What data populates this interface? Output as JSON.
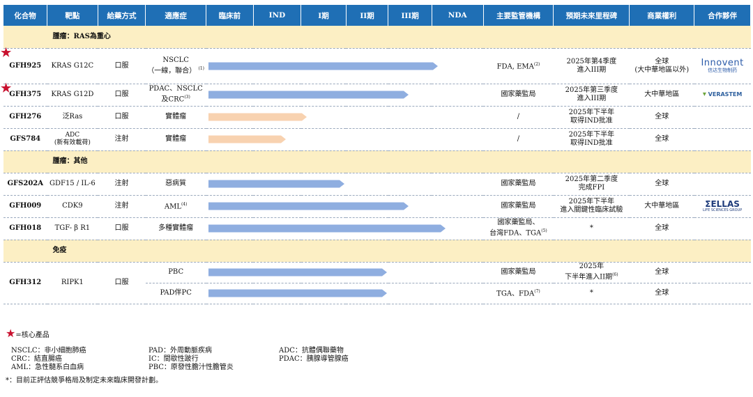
{
  "header": {
    "compound": "化合物",
    "target": "靶點",
    "route": "給藥方式",
    "indication": "適應症",
    "preclinical": "臨床前",
    "ind": "IND",
    "phase1": "I期",
    "phase2": "II期",
    "phase3": "III期",
    "nda": "NDA",
    "regulator": "主要監管機構",
    "milestone": "預期未來里程碑",
    "rights": "商業權利",
    "partner": "合作夥伴"
  },
  "sections": {
    "ras": "腫瘤：RAS為重心",
    "other": "腫瘤：其他",
    "immune": "免疫"
  },
  "rows": {
    "gfh925": {
      "compound": "GFH925",
      "target": "KRAS G12C",
      "route": "口服",
      "ind1": "NSCLC",
      "ind2": "（一線，聯合）",
      "ind_sup": "(1)",
      "regulator": "FDA, EMA",
      "reg_sup": "(2)",
      "ms1": "2025年第4季度",
      "ms2": "進入III期",
      "rights1": "全球",
      "rights2": "(大中華地區以外)",
      "partner_a": "Innovent",
      "partner_b": "信达生物制药",
      "progress": "Phase II"
    },
    "gfh375": {
      "compound": "GFH375",
      "target": "KRAS G12D",
      "route": "口服",
      "ind1": "PDAC、NSCLC",
      "ind2": "及CRC",
      "ind_sup": "(3)",
      "regulator": "國家藥監局",
      "ms1": "2025年第三季度",
      "ms2": "進入III期",
      "rights1": "大中華地區",
      "partner_a": "VERASTEM",
      "progress": "Phase II"
    },
    "gfh276": {
      "compound": "GFH276",
      "target": "泛Ras",
      "route": "口服",
      "ind1": "實體瘤",
      "regulator": "/",
      "ms1": "2025年下半年",
      "ms2": "取得IND批准",
      "rights1": "全球",
      "progress": "Preclinical"
    },
    "gfs784": {
      "compound": "GFS784",
      "target1": "ADC",
      "target2": "(新有效載荷)",
      "route": "注射",
      "ind1": "實體瘤",
      "regulator": "/",
      "ms1": "2025年下半年",
      "ms2": "取得IND批准",
      "rights1": "全球",
      "progress": "Preclinical"
    },
    "gfs202a": {
      "compound": "GFS202A",
      "target": "GDF15 / IL-6",
      "route": "注射",
      "ind1": "惡病質",
      "regulator": "國家藥監局",
      "ms1": "2025年第二季度",
      "ms2": "完成FPI",
      "rights1": "全球",
      "progress": "Phase I"
    },
    "gfh009": {
      "compound": "GFH009",
      "target": "CDK9",
      "route": "注射",
      "ind1": "AML",
      "ind_sup": "(4)",
      "regulator": "國家藥監局",
      "ms1": "2025年下半年",
      "ms2": "進入關鍵性臨床試驗",
      "rights1": "大中華地區",
      "partner_a": "ΣELLAS",
      "partner_b": "LIFE SCIENCES GROUP",
      "progress": "Phase II"
    },
    "gfh018": {
      "compound": "GFH018",
      "target": "TGF- β R1",
      "route": "口服",
      "ind1": "多種實體瘤",
      "regulator": "國家藥監局、",
      "regulator2": "台灣FDA、TGA",
      "reg_sup": "(5)",
      "ms1": "*",
      "rights1": "全球",
      "progress": "Phase II"
    },
    "gfh312": {
      "compound": "GFH312",
      "target": "RIPK1",
      "route": "口服",
      "sub1": {
        "ind1": "PBC",
        "regulator": "國家藥監局",
        "ms1": "2025年",
        "ms2": "下半年進入II期",
        "ms_sup": "(6)",
        "rights1": "全球",
        "progress": "Phase II"
      },
      "sub2": {
        "ind1": "PAD伴PC",
        "regulator": "TGA、FDA",
        "reg_sup": "(7)",
        "ms1": "*",
        "rights1": "全球",
        "progress": "Phase II"
      }
    }
  },
  "bar_fill": {
    "gfh925": 0.86,
    "gfh375": 0.75,
    "gfh276": 0.37,
    "gfs784": 0.29,
    "gfs202a": 0.51,
    "gfh009": 0.75,
    "gfh018": 0.89,
    "gfh312a": 0.67,
    "gfh312b": 0.67
  },
  "colors": {
    "header_bg": "#1f6fb5",
    "section_bg": "#fcefc4",
    "bar_blue": "#8faee0",
    "bar_peach": "#f8d2b0",
    "star": "#c8102e"
  },
  "legend": {
    "core": "=核心產品",
    "nsclc": "NSCLC：非小細胞肺癌",
    "crc": "CRC：結直腸癌",
    "aml": "AML：急性髓系白血病",
    "pad": "PAD：外周動脈疾病",
    "ic": "IC：間歇性跛行",
    "pbc": "PBC：原發性膽汁性膽管炎",
    "adc": "ADC：抗體偶聯藥物",
    "pdac": "PDAC：胰腺導管腺癌",
    "note": "*：目前正評估競爭格局及制定未來臨床開發計劃。"
  }
}
